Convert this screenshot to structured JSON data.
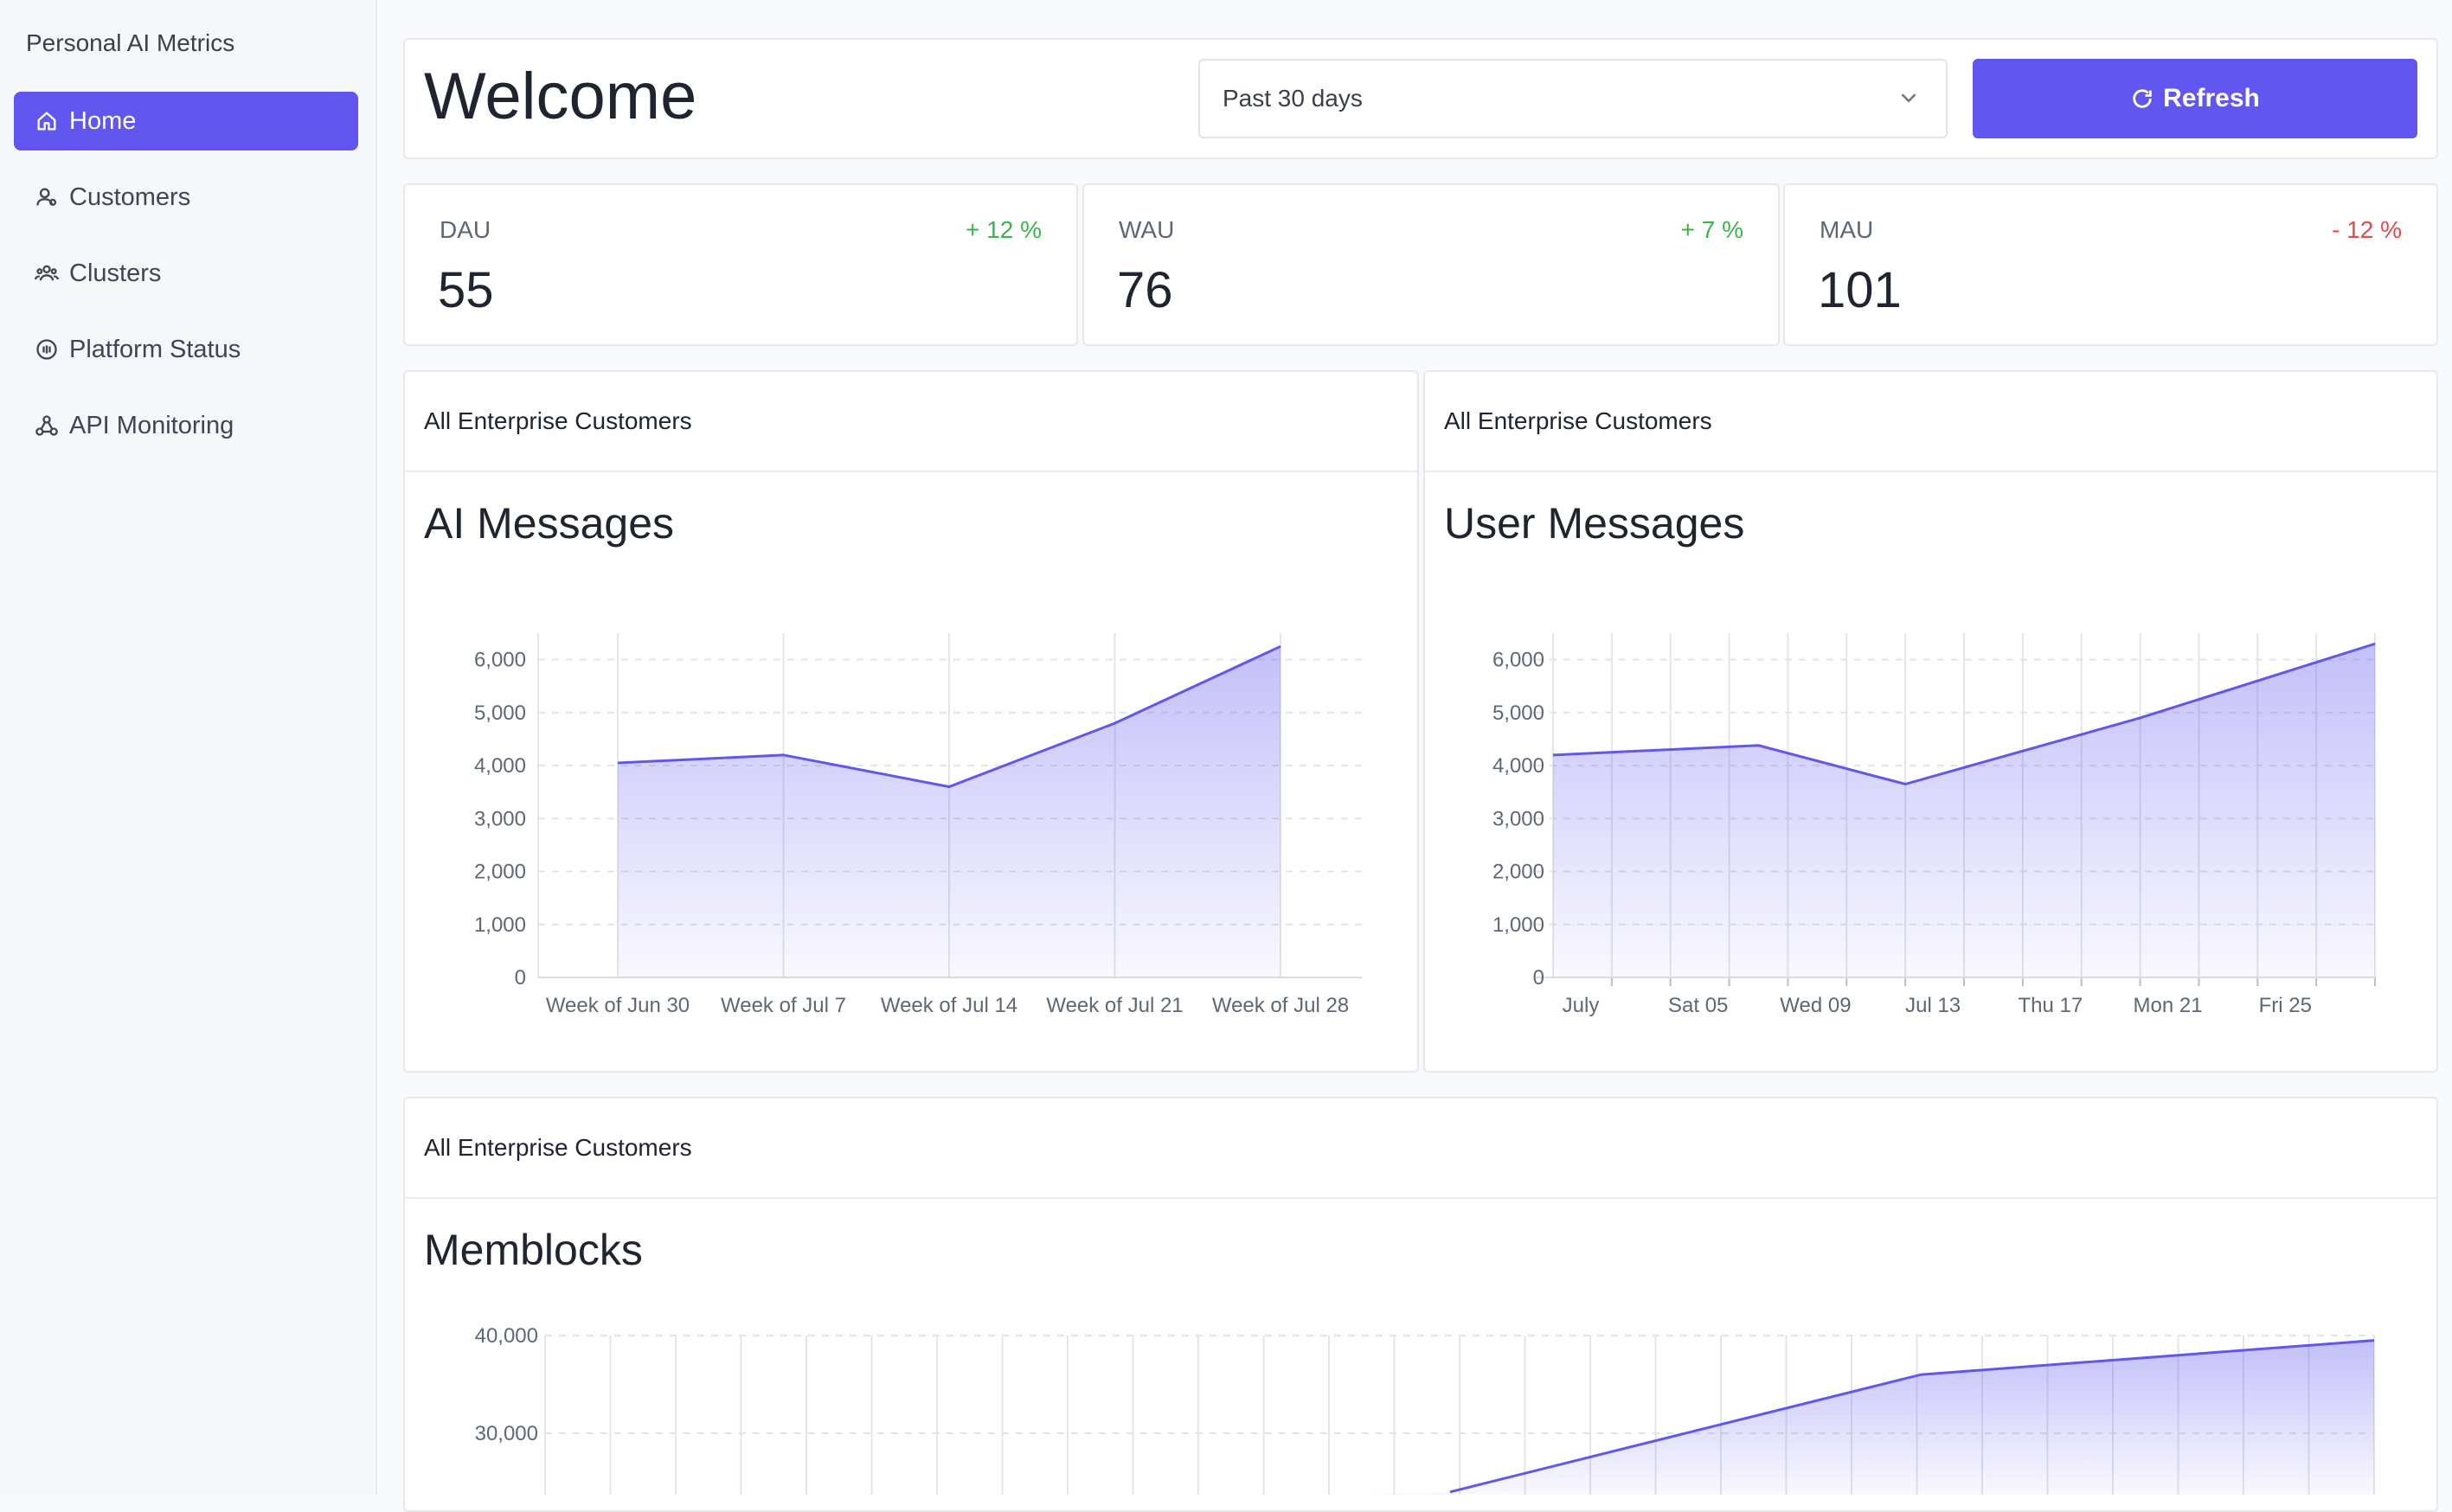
{
  "app_title": "Personal AI Metrics",
  "nav": [
    {
      "label": "Home",
      "icon": "home-icon"
    },
    {
      "label": "Customers",
      "icon": "customers-icon"
    },
    {
      "label": "Clusters",
      "icon": "clusters-icon"
    },
    {
      "label": "Platform Status",
      "icon": "status-icon"
    },
    {
      "label": "API Monitoring",
      "icon": "webhook-icon"
    }
  ],
  "header": {
    "title": "Welcome",
    "period_value": "Past 30 days",
    "refresh_label": "Refresh"
  },
  "metrics": [
    {
      "label": "DAU",
      "value": "55",
      "change": "+ 12 %",
      "color": "#3bb54a"
    },
    {
      "label": "WAU",
      "value": "76",
      "change": "+ 7 %",
      "color": "#3bb54a"
    },
    {
      "label": "MAU",
      "value": "101",
      "change": "- 12 %",
      "color": "#e5484d"
    }
  ],
  "accent_color": "#6157f0",
  "charts": {
    "ai_messages": {
      "section": "All Enterprise Customers",
      "title": "AI Messages"
    },
    "user_messages": {
      "section": "All Enterprise Customers",
      "title": "User Messages"
    },
    "memblocks": {
      "section": "All Enterprise Customers",
      "title": "Memblocks"
    }
  },
  "chart_data": [
    {
      "type": "area",
      "title": "AI Messages",
      "x": [
        "Week of Jun 30",
        "Week of Jul 7",
        "Week of Jul 14",
        "Week of Jul 21",
        "Week of Jul 28"
      ],
      "series": [
        {
          "values": [
            4050,
            4200,
            3600,
            4800,
            6250
          ]
        }
      ],
      "yticks": [
        "0",
        "1,000",
        "2,000",
        "3,000",
        "4,000",
        "5,000",
        "6,000"
      ],
      "ylim": [
        0,
        6500
      ],
      "grid": true
    },
    {
      "type": "area",
      "title": "User Messages",
      "xtick_labels": [
        "July",
        "Sat 05",
        "Wed 09",
        "Jul 13",
        "Thu 17",
        "Mon 21",
        "Fri 25"
      ],
      "x": [
        "2025-07-01",
        "2025-07-08",
        "2025-07-13",
        "2025-07-21",
        "2025-07-29"
      ],
      "series": [
        {
          "values": [
            4200,
            4380,
            3650,
            4900,
            6300
          ]
        }
      ],
      "yticks": [
        "0",
        "1,000",
        "2,000",
        "3,000",
        "4,000",
        "5,000",
        "6,000"
      ],
      "ylim": [
        0,
        6500
      ],
      "grid": true
    },
    {
      "type": "area",
      "title": "Memblocks",
      "series": [
        {
          "values": [
            24000,
            36000,
            39500
          ]
        }
      ],
      "yticks": [
        "30,000",
        "40,000"
      ],
      "grid": true
    }
  ]
}
